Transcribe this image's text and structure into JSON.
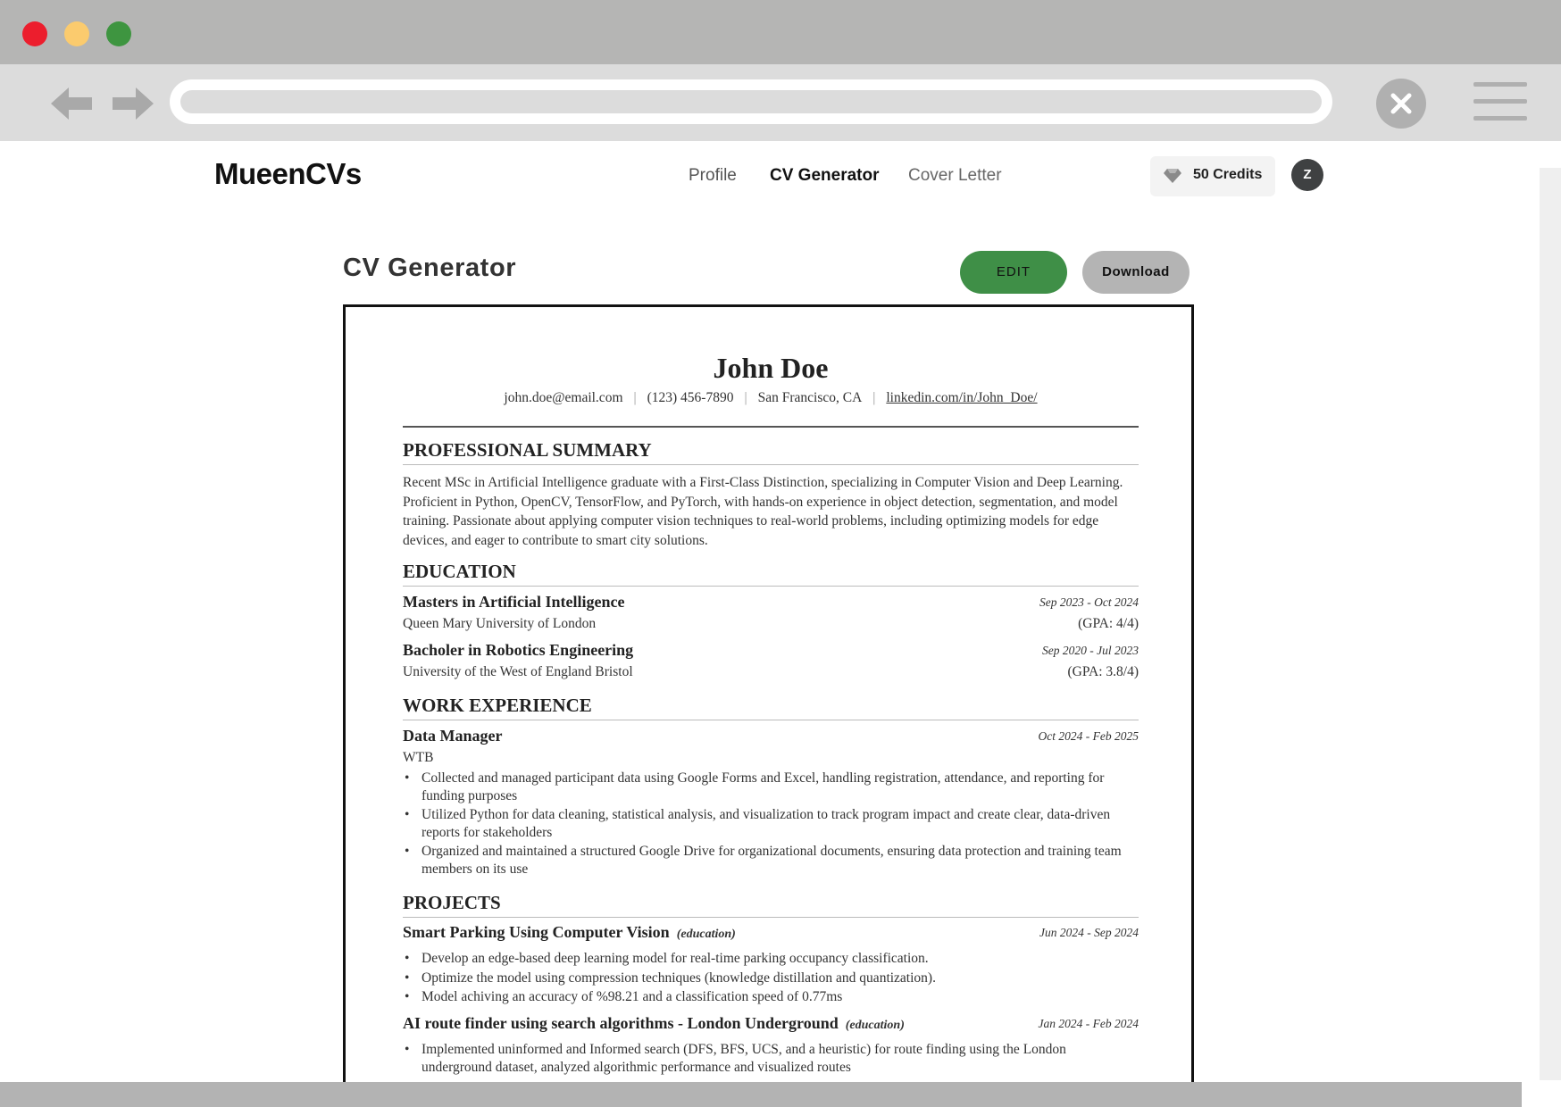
{
  "app": {
    "logo": "MueenCVs",
    "nav": {
      "profile": "Profile",
      "cv_generator": "CV Generator",
      "cover_letter": "Cover Letter"
    },
    "credits": "50 Credits",
    "avatar_initial": "Z"
  },
  "page": {
    "title": "CV Generator",
    "edit_label": "EDIT",
    "download_label": "Download"
  },
  "cv": {
    "name": "John Doe",
    "contact": {
      "email": "john.doe@email.com",
      "phone": "(123) 456-7890",
      "location": "San Francisco, CA",
      "linkedin": "linkedin.com/in/John_Doe/"
    },
    "summary_heading": "PROFESSIONAL SUMMARY",
    "summary": "Recent MSc in Artificial Intelligence graduate with a First-Class Distinction, specializing in Computer Vision and Deep Learning. Proficient in Python, OpenCV, TensorFlow, and PyTorch, with hands-on experience in object detection, segmentation, and model training. Passionate about applying computer vision techniques to real-world problems, including optimizing models for edge devices, and eager to contribute to smart city solutions.",
    "education_heading": "EDUCATION",
    "education": [
      {
        "degree": "Masters in Artificial Intelligence",
        "dates": "Sep 2023 - Oct 2024",
        "school": "Queen Mary University of London",
        "gpa": "(GPA: 4/4)"
      },
      {
        "degree": "Bacholer in Robotics Engineering",
        "dates": "Sep 2020 - Jul 2023",
        "school": "University of the West of England Bristol",
        "gpa": "(GPA: 3.8/4)"
      }
    ],
    "work_heading": "WORK EXPERIENCE",
    "work": [
      {
        "title": "Data Manager",
        "dates": "Oct 2024 - Feb 2025",
        "company": "WTB",
        "bullets": [
          "Collected and managed participant data using Google Forms and Excel, handling registration, attendance, and reporting for funding purposes",
          "Utilized Python for data cleaning, statistical analysis, and visualization to track program impact and create clear, data-driven reports for stakeholders",
          "Organized and maintained a structured Google Drive for organizational documents, ensuring data protection and training team members on its use"
        ]
      }
    ],
    "projects_heading": "PROJECTS",
    "projects": [
      {
        "title": "Smart Parking Using Computer Vision",
        "tag": "(education)",
        "dates": "Jun 2024 - Sep 2024",
        "bullets": [
          "Develop an edge-based deep learning model for real-time parking occupancy classification.",
          "Optimize the model using compression techniques (knowledge distillation and quantization).",
          "Model achiving an accuracy of %98.21 and a classification speed of 0.77ms"
        ]
      },
      {
        "title": "AI route finder using search algorithms - London Underground",
        "tag": "(education)",
        "dates": "Jan 2024 - Feb 2024",
        "bullets": [
          "Implemented uninformed and Informed search (DFS, BFS, UCS, and a heuristic) for route finding using the London underground dataset, analyzed algorithmic performance and visualized routes"
        ]
      }
    ]
  },
  "icons": {
    "back": "arrow-left-icon",
    "forward": "arrow-right-icon",
    "close": "close-icon",
    "menu": "hamburger-menu-icon",
    "credits": "diamond-icon"
  },
  "colors": {
    "edit_button": "#3f8f47",
    "download_button": "#b4b4b4",
    "traffic_red": "#ec1e2d",
    "traffic_yellow": "#fbcb6e",
    "traffic_green": "#3e9540"
  }
}
